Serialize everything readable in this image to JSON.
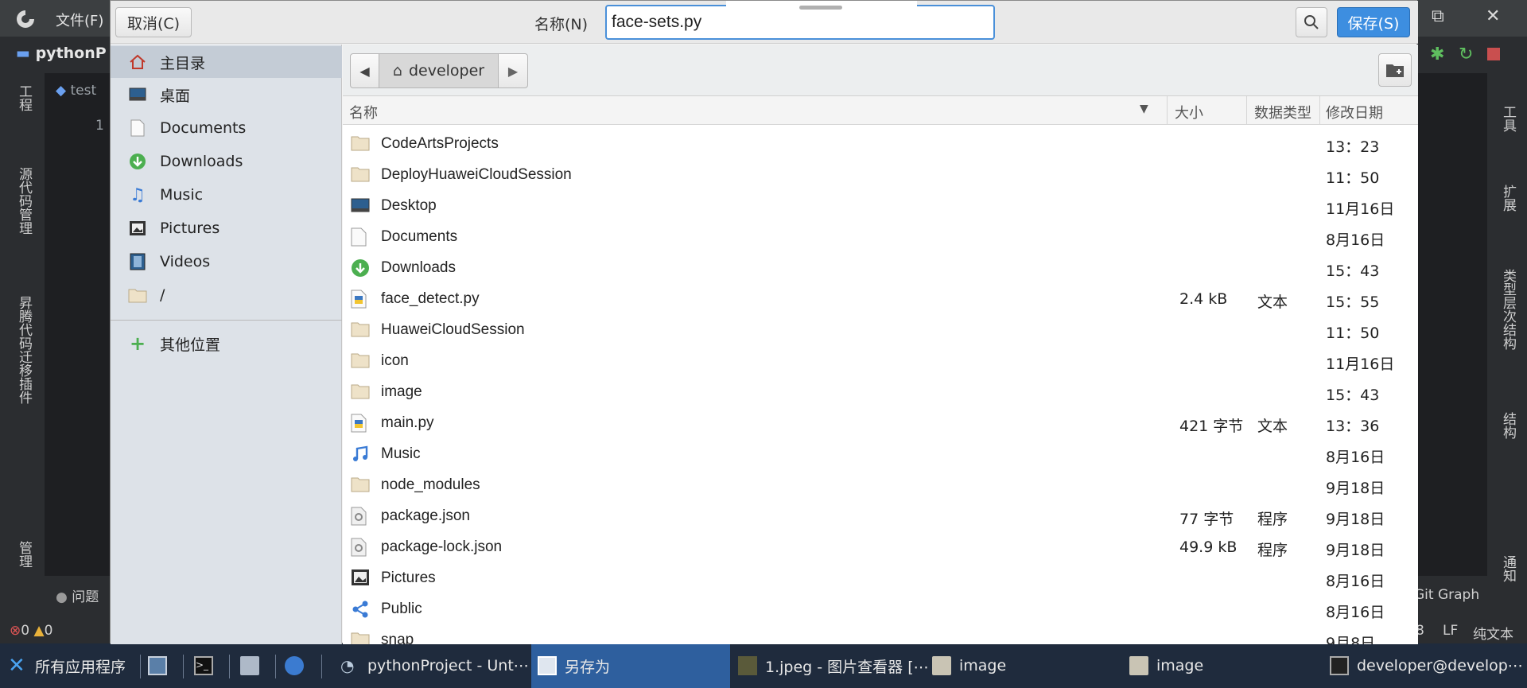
{
  "ide": {
    "file_menu": "文件(F)",
    "project_name": "pythonP",
    "editor_tab": "test",
    "line_number": "1",
    "left_tools": [
      "工程",
      "源代码管理",
      "昇腾代码迁移插件",
      "管理"
    ],
    "right_tools": [
      "工具",
      "扩展",
      "类型层次结构",
      "结构",
      "通知"
    ],
    "issues_tab": "问题",
    "git_graph": "Git Graph",
    "status": {
      "errors": "0",
      "warnings": "0",
      "line_ending": "LF",
      "file_type": "纯文本",
      "col": "8"
    }
  },
  "dialog": {
    "cancel_label": "取消(C)",
    "name_label": "名称(N)",
    "filename_value": "face-sets.py",
    "save_label": "保存(S)",
    "sidebar": [
      {
        "label": "主目录",
        "icon": "home-icon"
      },
      {
        "label": "桌面",
        "icon": "desktop-icon"
      },
      {
        "label": "Documents",
        "icon": "document-icon"
      },
      {
        "label": "Downloads",
        "icon": "download-icon"
      },
      {
        "label": "Music",
        "icon": "music-icon"
      },
      {
        "label": "Pictures",
        "icon": "pictures-icon"
      },
      {
        "label": "Videos",
        "icon": "videos-icon"
      },
      {
        "label": "/",
        "icon": "folder-icon"
      }
    ],
    "other_locations": "其他位置",
    "path_crumb": "developer",
    "columns": {
      "name": "名称",
      "size": "大小",
      "type": "数据类型",
      "modified": "修改日期"
    },
    "files": [
      {
        "name": "CodeArtsProjects",
        "size": "",
        "type": "",
        "modified": "13：23",
        "icon": "folder"
      },
      {
        "name": "DeployHuaweiCloudSession",
        "size": "",
        "type": "",
        "modified": "11：50",
        "icon": "folder"
      },
      {
        "name": "Desktop",
        "size": "",
        "type": "",
        "modified": "11月16日",
        "icon": "desktop"
      },
      {
        "name": "Documents",
        "size": "",
        "type": "",
        "modified": "8月16日",
        "icon": "document"
      },
      {
        "name": "Downloads",
        "size": "",
        "type": "",
        "modified": "15：43",
        "icon": "download"
      },
      {
        "name": "face_detect.py",
        "size": "2.4 kB",
        "type": "文本",
        "modified": "15：55",
        "icon": "python"
      },
      {
        "name": "HuaweiCloudSession",
        "size": "",
        "type": "",
        "modified": "11：50",
        "icon": "folder"
      },
      {
        "name": "icon",
        "size": "",
        "type": "",
        "modified": "11月16日",
        "icon": "folder"
      },
      {
        "name": "image",
        "size": "",
        "type": "",
        "modified": "15：43",
        "icon": "folder"
      },
      {
        "name": "main.py",
        "size": "421 字节",
        "type": "文本",
        "modified": "13：36",
        "icon": "python"
      },
      {
        "name": "Music",
        "size": "",
        "type": "",
        "modified": "8月16日",
        "icon": "music"
      },
      {
        "name": "node_modules",
        "size": "",
        "type": "",
        "modified": "9月18日",
        "icon": "folder"
      },
      {
        "name": "package.json",
        "size": "77 字节",
        "type": "程序",
        "modified": "9月18日",
        "icon": "json"
      },
      {
        "name": "package-lock.json",
        "size": "49.9 kB",
        "type": "程序",
        "modified": "9月18日",
        "icon": "json"
      },
      {
        "name": "Pictures",
        "size": "",
        "type": "",
        "modified": "8月16日",
        "icon": "pictures"
      },
      {
        "name": "Public",
        "size": "",
        "type": "",
        "modified": "8月16日",
        "icon": "share"
      },
      {
        "name": "snap",
        "size": "",
        "type": "",
        "modified": "9月8日",
        "icon": "folder"
      }
    ]
  },
  "taskbar": {
    "apps_label": "所有应用程序",
    "tasks": [
      {
        "label": "pythonProject - Unt⋯"
      },
      {
        "label": "另存为"
      },
      {
        "label": "1.jpeg - 图片查看器 [⋯"
      },
      {
        "label": "image"
      },
      {
        "label": "image"
      },
      {
        "label": "developer@develop⋯"
      }
    ]
  },
  "colors": {
    "accent": "#3d8ee0",
    "taskbar": "#1f2b3d",
    "sidebar": "#dde2e8"
  }
}
